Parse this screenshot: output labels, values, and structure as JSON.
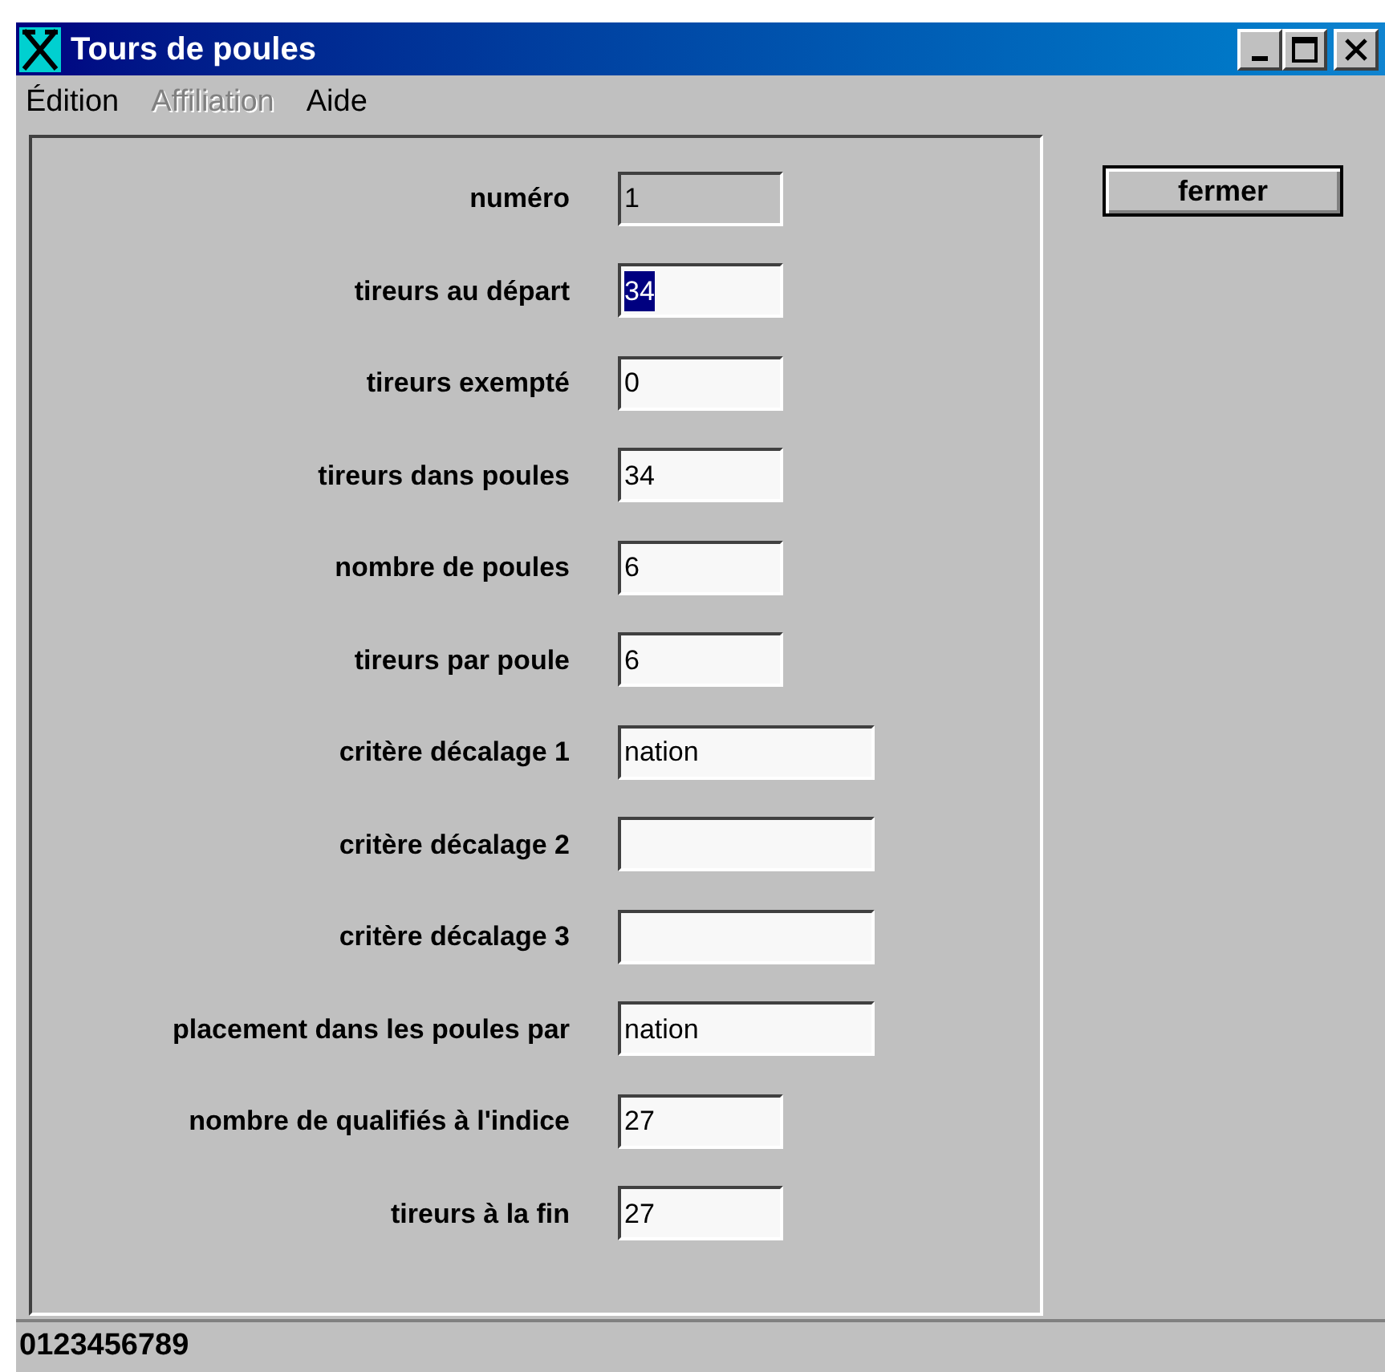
{
  "window": {
    "title": "Tours de poules"
  },
  "menu": [
    {
      "label": "Édition",
      "disabled": false
    },
    {
      "label": "Affiliation",
      "disabled": true
    },
    {
      "label": "Aide",
      "disabled": false
    }
  ],
  "fields": [
    {
      "label": "numéro",
      "value": "1",
      "kind": "short",
      "disabled": true,
      "text_selected": false
    },
    {
      "label": "tireurs au départ",
      "value": "34",
      "kind": "short",
      "disabled": false,
      "text_selected": true
    },
    {
      "label": "tireurs exempté",
      "value": "0",
      "kind": "short",
      "disabled": false,
      "text_selected": false
    },
    {
      "label": "tireurs dans poules",
      "value": "34",
      "kind": "short",
      "disabled": false,
      "text_selected": false
    },
    {
      "label": "nombre de poules",
      "value": "6",
      "kind": "short",
      "disabled": false,
      "text_selected": false
    },
    {
      "label": "tireurs par poule",
      "value": "6",
      "kind": "short",
      "disabled": false,
      "text_selected": false
    },
    {
      "label": "critère décalage 1",
      "value": "nation",
      "kind": "long",
      "disabled": false,
      "text_selected": false
    },
    {
      "label": "critère décalage 2",
      "kind": "long",
      "disabled": false
    },
    {
      "label": "critère décalage 3",
      "kind": "long",
      "disabled": false
    },
    {
      "label": "placement dans les poules par",
      "value": "nation",
      "kind": "long",
      "disabled": false,
      "text_selected": false
    },
    {
      "label": "nombre de qualifiés à l'indice",
      "value": "27",
      "kind": "short",
      "disabled": false,
      "text_selected": false
    },
    {
      "label": "tireurs à la fin",
      "value": "27",
      "kind": "short",
      "disabled": false,
      "text_selected": false
    }
  ],
  "close_button": "fermer",
  "status_bar": "0123456789"
}
